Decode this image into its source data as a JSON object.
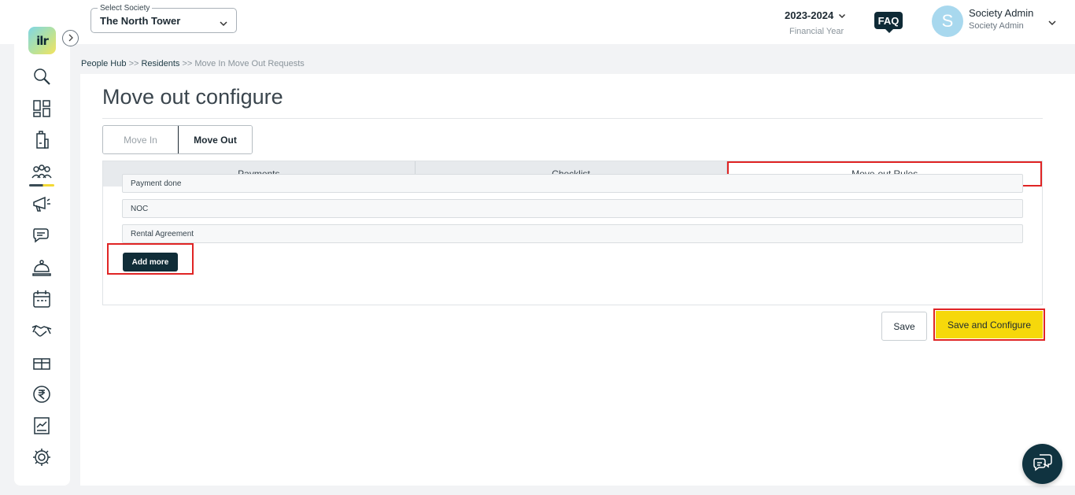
{
  "topbar": {
    "society_label": "Select Society",
    "society_value": "The North Tower",
    "financial_year_value": "2023-2024",
    "financial_year_label": "Financial Year",
    "faq_label": "FAQ",
    "avatar_initial": "S",
    "user_name": "Society Admin",
    "user_role": "Society Admin"
  },
  "sidebar": {
    "logo_text": "ilr",
    "items": [
      {
        "icon": "search-icon"
      },
      {
        "icon": "dashboard-icon"
      },
      {
        "icon": "building-icon"
      },
      {
        "icon": "people-icon",
        "active": true
      },
      {
        "icon": "megaphone-icon"
      },
      {
        "icon": "chat-icon"
      },
      {
        "icon": "service-bell-icon"
      },
      {
        "icon": "calendar-icon"
      },
      {
        "icon": "handshake-icon"
      },
      {
        "icon": "gift-icon"
      },
      {
        "icon": "rupee-icon"
      },
      {
        "icon": "report-icon"
      },
      {
        "icon": "gear-icon"
      }
    ]
  },
  "breadcrumb": {
    "item1": "People Hub",
    "item2": "Residents",
    "item3": "Move In Move Out Requests",
    "separator": ">>"
  },
  "main": {
    "title": "Move out configure",
    "toggle": {
      "move_in": "Move In",
      "move_out": "Move Out"
    },
    "tabs": [
      {
        "label": "Payments"
      },
      {
        "label": "Checklist"
      },
      {
        "label": "Move-out Rules"
      }
    ],
    "rules": [
      {
        "value": "Payment done"
      },
      {
        "value": "NOC"
      },
      {
        "value": "Rental Agreement"
      }
    ],
    "add_more_label": "Add more",
    "save_label": "Save",
    "save_configure_label": "Save and Configure"
  },
  "colors": {
    "accent_yellow": "#f6d80b",
    "dark_navy": "#102d38",
    "highlight_red": "#e02424"
  }
}
